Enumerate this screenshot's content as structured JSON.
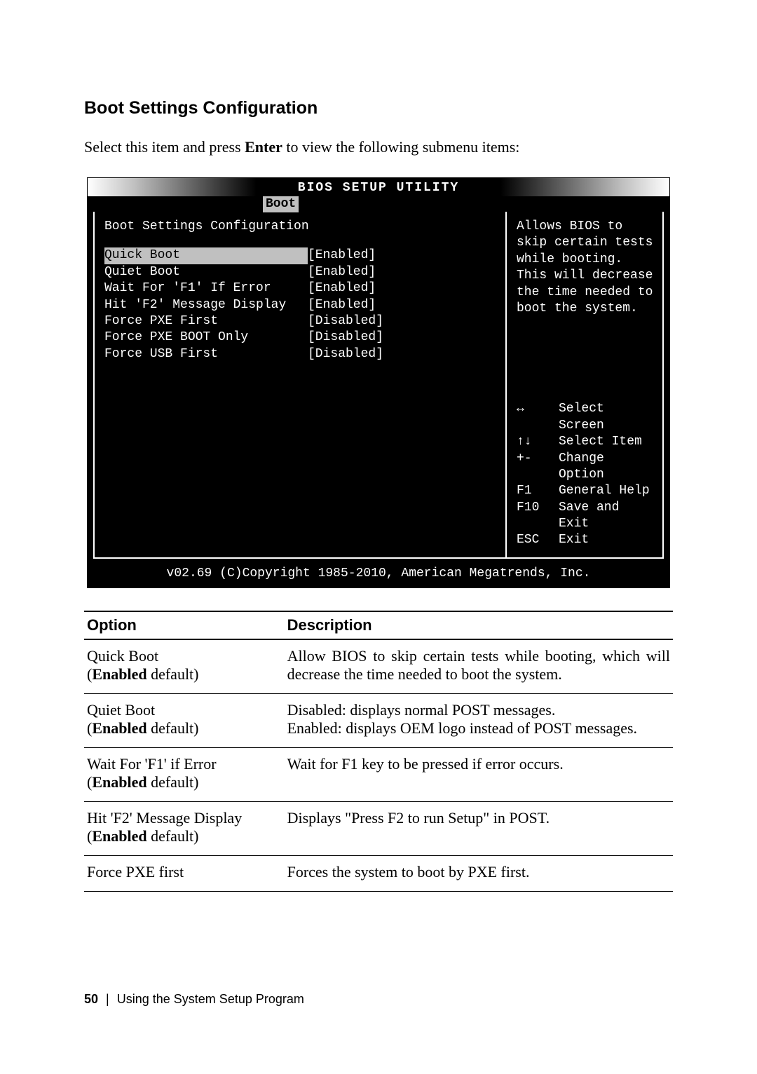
{
  "heading": "Boot Settings Configuration",
  "intro_prefix": "Select this item and press ",
  "intro_enter": "Enter",
  "intro_suffix": " to view the following submenu items:",
  "bios": {
    "title": "BIOS SETUP UTILITY",
    "tab": "Boot",
    "section": "Boot Settings Configuration",
    "rows": [
      {
        "label": "Quick Boot",
        "value": "[Enabled]",
        "highlight": true
      },
      {
        "label": "Quiet Boot",
        "value": "[Enabled]"
      },
      {
        "label": "Wait For 'F1' If Error",
        "value": "[Enabled]"
      },
      {
        "label": "Hit 'F2' Message Display",
        "value": "[Enabled]"
      },
      {
        "label": "Force PXE First",
        "value": "[Disabled]"
      },
      {
        "label": "Force PXE BOOT Only",
        "value": "[Disabled]"
      },
      {
        "label": "Force USB First",
        "value": "[Disabled]"
      }
    ],
    "help": "Allows BIOS to skip certain tests while booting. This will decrease the time needed to boot the system.",
    "keys": [
      {
        "key": "↔",
        "label": "Select Screen"
      },
      {
        "key": "↑↓",
        "label": "Select Item"
      },
      {
        "key": "+-",
        "label": "Change Option"
      },
      {
        "key": "F1",
        "label": "General Help"
      },
      {
        "key": "F10",
        "label": "Save and Exit"
      },
      {
        "key": "ESC",
        "label": "Exit"
      }
    ],
    "copyright": "v02.69 (C)Copyright 1985-2010, American Megatrends, Inc."
  },
  "table": {
    "head_option": "Option",
    "head_desc": "Description",
    "rows": [
      {
        "name": "Quick Boot",
        "paren_open": "(",
        "default_word": "Enabled",
        "paren_close": " default)",
        "desc": "Allow BIOS to skip certain tests while booting, which will decrease the time needed to boot the system."
      },
      {
        "name": "Quiet Boot",
        "paren_open": "(",
        "default_word": "Enabled",
        "paren_close": " default)",
        "desc": "Disabled: displays normal POST messages.\nEnabled: displays OEM logo instead of POST messages."
      },
      {
        "name": "Wait For 'F1' if Error",
        "paren_open": "(",
        "default_word": "Enabled",
        "paren_close": " default)",
        "desc": "Wait for F1 key to be pressed if error occurs."
      },
      {
        "name": "Hit 'F2' Message Display",
        "paren_open": "(",
        "default_word": "Enabled",
        "paren_close": " default)",
        "desc": "Displays \"Press F2 to run Setup\" in POST."
      },
      {
        "name": "Force PXE first",
        "paren_open": "",
        "default_word": "",
        "paren_close": "",
        "desc": "Forces the system to boot by PXE first."
      }
    ]
  },
  "footer": {
    "page": "50",
    "sep": "|",
    "chapter": "Using the System Setup Program"
  }
}
